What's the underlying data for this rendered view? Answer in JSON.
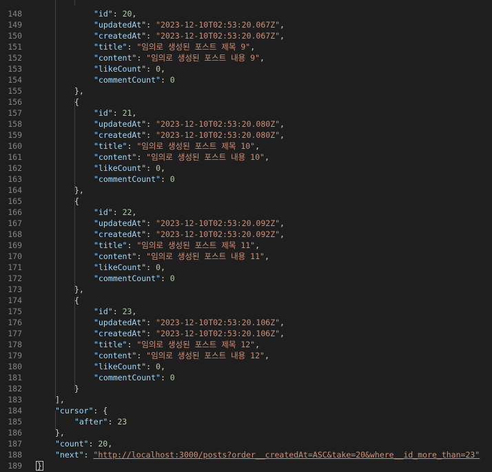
{
  "editor": {
    "lines": [
      {
        "no": "148",
        "indent": 3,
        "parts": [
          {
            "t": "key",
            "v": "\"id\""
          },
          {
            "t": "punc",
            "v": ": "
          },
          {
            "t": "num",
            "v": "20"
          },
          {
            "t": "punc",
            "v": ","
          }
        ]
      },
      {
        "no": "149",
        "indent": 3,
        "parts": [
          {
            "t": "key",
            "v": "\"updatedAt\""
          },
          {
            "t": "punc",
            "v": ": "
          },
          {
            "t": "str",
            "v": "\"2023-12-10T02:53:20.067Z\""
          },
          {
            "t": "punc",
            "v": ","
          }
        ]
      },
      {
        "no": "150",
        "indent": 3,
        "parts": [
          {
            "t": "key",
            "v": "\"createdAt\""
          },
          {
            "t": "punc",
            "v": ": "
          },
          {
            "t": "str",
            "v": "\"2023-12-10T02:53:20.067Z\""
          },
          {
            "t": "punc",
            "v": ","
          }
        ]
      },
      {
        "no": "151",
        "indent": 3,
        "parts": [
          {
            "t": "key",
            "v": "\"title\""
          },
          {
            "t": "punc",
            "v": ": "
          },
          {
            "t": "str",
            "v": "\"임의로 생성된 포스트 제목 9\""
          },
          {
            "t": "punc",
            "v": ","
          }
        ]
      },
      {
        "no": "152",
        "indent": 3,
        "parts": [
          {
            "t": "key",
            "v": "\"content\""
          },
          {
            "t": "punc",
            "v": ": "
          },
          {
            "t": "str",
            "v": "\"임의로 생성된 포스트 내용 9\""
          },
          {
            "t": "punc",
            "v": ","
          }
        ]
      },
      {
        "no": "153",
        "indent": 3,
        "parts": [
          {
            "t": "key",
            "v": "\"likeCount\""
          },
          {
            "t": "punc",
            "v": ": "
          },
          {
            "t": "num",
            "v": "0"
          },
          {
            "t": "punc",
            "v": ","
          }
        ]
      },
      {
        "no": "154",
        "indent": 3,
        "parts": [
          {
            "t": "key",
            "v": "\"commentCount\""
          },
          {
            "t": "punc",
            "v": ": "
          },
          {
            "t": "num",
            "v": "0"
          }
        ]
      },
      {
        "no": "155",
        "indent": 2,
        "parts": [
          {
            "t": "punc",
            "v": "},"
          }
        ]
      },
      {
        "no": "156",
        "indent": 2,
        "parts": [
          {
            "t": "punc",
            "v": "{"
          }
        ]
      },
      {
        "no": "157",
        "indent": 3,
        "parts": [
          {
            "t": "key",
            "v": "\"id\""
          },
          {
            "t": "punc",
            "v": ": "
          },
          {
            "t": "num",
            "v": "21"
          },
          {
            "t": "punc",
            "v": ","
          }
        ]
      },
      {
        "no": "158",
        "indent": 3,
        "parts": [
          {
            "t": "key",
            "v": "\"updatedAt\""
          },
          {
            "t": "punc",
            "v": ": "
          },
          {
            "t": "str",
            "v": "\"2023-12-10T02:53:20.080Z\""
          },
          {
            "t": "punc",
            "v": ","
          }
        ]
      },
      {
        "no": "159",
        "indent": 3,
        "parts": [
          {
            "t": "key",
            "v": "\"createdAt\""
          },
          {
            "t": "punc",
            "v": ": "
          },
          {
            "t": "str",
            "v": "\"2023-12-10T02:53:20.080Z\""
          },
          {
            "t": "punc",
            "v": ","
          }
        ]
      },
      {
        "no": "160",
        "indent": 3,
        "parts": [
          {
            "t": "key",
            "v": "\"title\""
          },
          {
            "t": "punc",
            "v": ": "
          },
          {
            "t": "str",
            "v": "\"임의로 생성된 포스트 제목 10\""
          },
          {
            "t": "punc",
            "v": ","
          }
        ]
      },
      {
        "no": "161",
        "indent": 3,
        "parts": [
          {
            "t": "key",
            "v": "\"content\""
          },
          {
            "t": "punc",
            "v": ": "
          },
          {
            "t": "str",
            "v": "\"임의로 생성된 포스트 내용 10\""
          },
          {
            "t": "punc",
            "v": ","
          }
        ]
      },
      {
        "no": "162",
        "indent": 3,
        "parts": [
          {
            "t": "key",
            "v": "\"likeCount\""
          },
          {
            "t": "punc",
            "v": ": "
          },
          {
            "t": "num",
            "v": "0"
          },
          {
            "t": "punc",
            "v": ","
          }
        ]
      },
      {
        "no": "163",
        "indent": 3,
        "parts": [
          {
            "t": "key",
            "v": "\"commentCount\""
          },
          {
            "t": "punc",
            "v": ": "
          },
          {
            "t": "num",
            "v": "0"
          }
        ]
      },
      {
        "no": "164",
        "indent": 2,
        "parts": [
          {
            "t": "punc",
            "v": "},"
          }
        ]
      },
      {
        "no": "165",
        "indent": 2,
        "parts": [
          {
            "t": "punc",
            "v": "{"
          }
        ]
      },
      {
        "no": "166",
        "indent": 3,
        "parts": [
          {
            "t": "key",
            "v": "\"id\""
          },
          {
            "t": "punc",
            "v": ": "
          },
          {
            "t": "num",
            "v": "22"
          },
          {
            "t": "punc",
            "v": ","
          }
        ]
      },
      {
        "no": "167",
        "indent": 3,
        "parts": [
          {
            "t": "key",
            "v": "\"updatedAt\""
          },
          {
            "t": "punc",
            "v": ": "
          },
          {
            "t": "str",
            "v": "\"2023-12-10T02:53:20.092Z\""
          },
          {
            "t": "punc",
            "v": ","
          }
        ]
      },
      {
        "no": "168",
        "indent": 3,
        "parts": [
          {
            "t": "key",
            "v": "\"createdAt\""
          },
          {
            "t": "punc",
            "v": ": "
          },
          {
            "t": "str",
            "v": "\"2023-12-10T02:53:20.092Z\""
          },
          {
            "t": "punc",
            "v": ","
          }
        ]
      },
      {
        "no": "169",
        "indent": 3,
        "parts": [
          {
            "t": "key",
            "v": "\"title\""
          },
          {
            "t": "punc",
            "v": ": "
          },
          {
            "t": "str",
            "v": "\"임의로 생성된 포스트 제목 11\""
          },
          {
            "t": "punc",
            "v": ","
          }
        ]
      },
      {
        "no": "170",
        "indent": 3,
        "parts": [
          {
            "t": "key",
            "v": "\"content\""
          },
          {
            "t": "punc",
            "v": ": "
          },
          {
            "t": "str",
            "v": "\"임의로 생성된 포스트 내용 11\""
          },
          {
            "t": "punc",
            "v": ","
          }
        ]
      },
      {
        "no": "171",
        "indent": 3,
        "parts": [
          {
            "t": "key",
            "v": "\"likeCount\""
          },
          {
            "t": "punc",
            "v": ": "
          },
          {
            "t": "num",
            "v": "0"
          },
          {
            "t": "punc",
            "v": ","
          }
        ]
      },
      {
        "no": "172",
        "indent": 3,
        "parts": [
          {
            "t": "key",
            "v": "\"commentCount\""
          },
          {
            "t": "punc",
            "v": ": "
          },
          {
            "t": "num",
            "v": "0"
          }
        ]
      },
      {
        "no": "173",
        "indent": 2,
        "parts": [
          {
            "t": "punc",
            "v": "},"
          }
        ]
      },
      {
        "no": "174",
        "indent": 2,
        "parts": [
          {
            "t": "punc",
            "v": "{"
          }
        ]
      },
      {
        "no": "175",
        "indent": 3,
        "parts": [
          {
            "t": "key",
            "v": "\"id\""
          },
          {
            "t": "punc",
            "v": ": "
          },
          {
            "t": "num",
            "v": "23"
          },
          {
            "t": "punc",
            "v": ","
          }
        ]
      },
      {
        "no": "176",
        "indent": 3,
        "parts": [
          {
            "t": "key",
            "v": "\"updatedAt\""
          },
          {
            "t": "punc",
            "v": ": "
          },
          {
            "t": "str",
            "v": "\"2023-12-10T02:53:20.106Z\""
          },
          {
            "t": "punc",
            "v": ","
          }
        ]
      },
      {
        "no": "177",
        "indent": 3,
        "parts": [
          {
            "t": "key",
            "v": "\"createdAt\""
          },
          {
            "t": "punc",
            "v": ": "
          },
          {
            "t": "str",
            "v": "\"2023-12-10T02:53:20.106Z\""
          },
          {
            "t": "punc",
            "v": ","
          }
        ]
      },
      {
        "no": "178",
        "indent": 3,
        "parts": [
          {
            "t": "key",
            "v": "\"title\""
          },
          {
            "t": "punc",
            "v": ": "
          },
          {
            "t": "str",
            "v": "\"임의로 생성된 포스트 제목 12\""
          },
          {
            "t": "punc",
            "v": ","
          }
        ]
      },
      {
        "no": "179",
        "indent": 3,
        "parts": [
          {
            "t": "key",
            "v": "\"content\""
          },
          {
            "t": "punc",
            "v": ": "
          },
          {
            "t": "str",
            "v": "\"임의로 생성된 포스트 내용 12\""
          },
          {
            "t": "punc",
            "v": ","
          }
        ]
      },
      {
        "no": "180",
        "indent": 3,
        "parts": [
          {
            "t": "key",
            "v": "\"likeCount\""
          },
          {
            "t": "punc",
            "v": ": "
          },
          {
            "t": "num",
            "v": "0"
          },
          {
            "t": "punc",
            "v": ","
          }
        ]
      },
      {
        "no": "181",
        "indent": 3,
        "parts": [
          {
            "t": "key",
            "v": "\"commentCount\""
          },
          {
            "t": "punc",
            "v": ": "
          },
          {
            "t": "num",
            "v": "0"
          }
        ]
      },
      {
        "no": "182",
        "indent": 2,
        "parts": [
          {
            "t": "punc",
            "v": "}"
          }
        ]
      },
      {
        "no": "183",
        "indent": 1,
        "parts": [
          {
            "t": "punc",
            "v": "],"
          }
        ]
      },
      {
        "no": "184",
        "indent": 1,
        "parts": [
          {
            "t": "key",
            "v": "\"cursor\""
          },
          {
            "t": "punc",
            "v": ": {"
          }
        ]
      },
      {
        "no": "185",
        "indent": 2,
        "parts": [
          {
            "t": "key",
            "v": "\"after\""
          },
          {
            "t": "punc",
            "v": ": "
          },
          {
            "t": "num",
            "v": "23"
          }
        ]
      },
      {
        "no": "186",
        "indent": 1,
        "parts": [
          {
            "t": "punc",
            "v": "},"
          }
        ]
      },
      {
        "no": "187",
        "indent": 1,
        "parts": [
          {
            "t": "key",
            "v": "\"count\""
          },
          {
            "t": "punc",
            "v": ": "
          },
          {
            "t": "num",
            "v": "20"
          },
          {
            "t": "punc",
            "v": ","
          }
        ]
      },
      {
        "no": "188",
        "indent": 1,
        "parts": [
          {
            "t": "key",
            "v": "\"next\""
          },
          {
            "t": "punc",
            "v": ": "
          },
          {
            "t": "link",
            "v": "\"http://localhost:3000/posts?order__createdAt=ASC&take=20&where__id_more_than=23\""
          }
        ]
      },
      {
        "no": "189",
        "indent": 0,
        "parts": [
          {
            "t": "cursor",
            "v": "}"
          }
        ]
      }
    ]
  }
}
